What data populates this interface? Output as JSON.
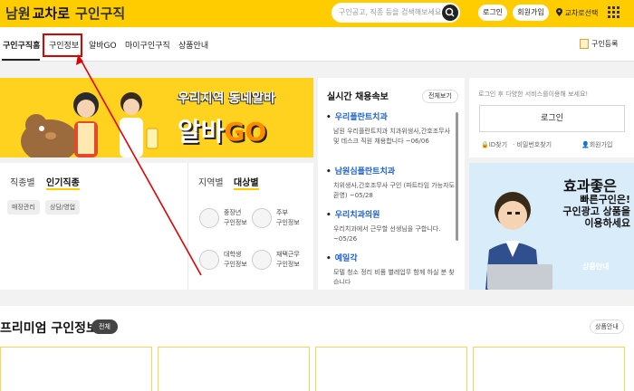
{
  "header": {
    "logo_region": "남원",
    "logo_brand": "교차로",
    "logo_suffix": "구인구직",
    "search_placeholder": "구인공고, 직종 등을 검색해보세요",
    "search_icon": "search-icon",
    "login_label": "로그인",
    "signup_label": "회원가입",
    "location_label": "교차로선택",
    "menu_icon": "grid-menu-icon"
  },
  "nav": {
    "items": [
      "구인구직홈",
      "구인정보",
      "알바GO",
      "마이구인구직",
      "상품안내"
    ],
    "register_label": "구인등록"
  },
  "banner": {
    "line1": "우리지역 동네알바",
    "line2_a": "알바",
    "line2_b": "GO"
  },
  "category": {
    "tabs_left": [
      "직종별",
      "인기직종"
    ],
    "chips": [
      "매장관리",
      "상담/영업"
    ],
    "tabs_right": [
      "지역별",
      "대상별"
    ],
    "targets": [
      {
        "line1": "중장년",
        "line2": "구인정보"
      },
      {
        "line1": "주부",
        "line2": "구인정보"
      },
      {
        "line1": "대학생",
        "line2": "구인정보"
      },
      {
        "line1": "재택근무",
        "line2": "구인정보"
      }
    ]
  },
  "realtime": {
    "title": "실시간 채용속보",
    "all_label": "전체보기",
    "items": [
      {
        "name": "우리플란트치과",
        "desc": "남원 우리플란트치과 치과위생사,간호조무사 및 데스크 직원 채용합니다 ~06/06"
      },
      {
        "name": "남원심플란트치과",
        "desc": "치위생사,간호조무사 구인 (파트타임 가능자도 환영) ~05/28"
      },
      {
        "name": "우리치과의원",
        "desc": "우리치과에서 근무할 선생님을 구합니다. ~05/26"
      },
      {
        "name": "예일각",
        "desc": "모텔 청소 정리 비품 별레업무 함께 하실 분 찾습니다"
      }
    ]
  },
  "login_box": {
    "message": "로그인 후 다양한 서비스를이용해 보세요!",
    "login_button": "로그인",
    "find_id": "ID찾기",
    "find_pw": "비밀번호찾기",
    "join": "회원가입"
  },
  "ad": {
    "line1": "효과좋은",
    "line2": "빠른구인은!",
    "line3": "구인광고 상품을",
    "line4": "이용하세요",
    "link": "상품안내"
  },
  "premium": {
    "title": "프리미엄 구인정보",
    "all_label": "전체",
    "info_label": "상품안내"
  },
  "colors": {
    "brand_yellow": "#ffcc00",
    "highlight_red": "#e00000",
    "link_blue": "#1a5fd0",
    "ad_blue": "#d9ecfa"
  }
}
